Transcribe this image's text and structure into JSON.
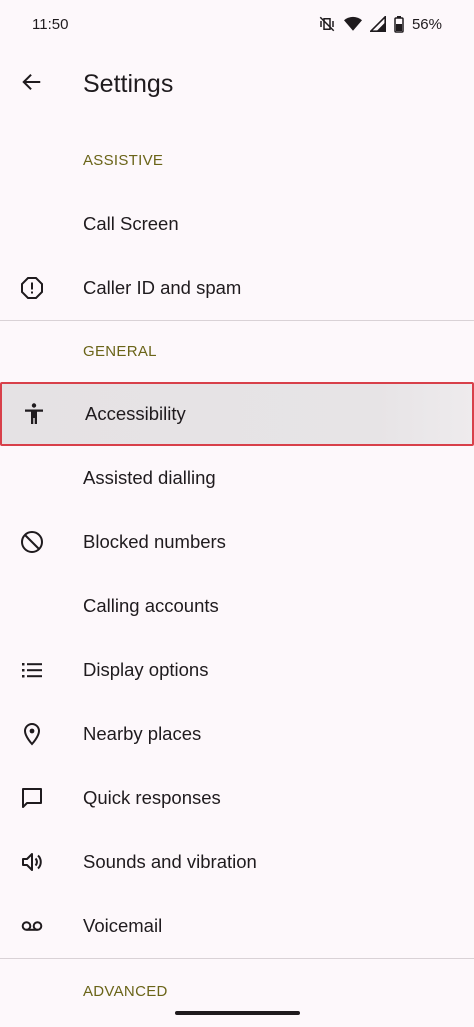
{
  "status_bar": {
    "time": "11:50",
    "battery": "56%"
  },
  "app_bar": {
    "title": "Settings"
  },
  "sections": {
    "assistive": {
      "header": "ASSISTIVE",
      "items": [
        "Call Screen",
        "Caller ID and spam"
      ]
    },
    "general": {
      "header": "GENERAL",
      "items": [
        "Accessibility",
        "Assisted dialling",
        "Blocked numbers",
        "Calling accounts",
        "Display options",
        "Nearby places",
        "Quick responses",
        "Sounds and vibration",
        "Voicemail"
      ]
    },
    "advanced": {
      "header": "ADVANCED"
    }
  }
}
